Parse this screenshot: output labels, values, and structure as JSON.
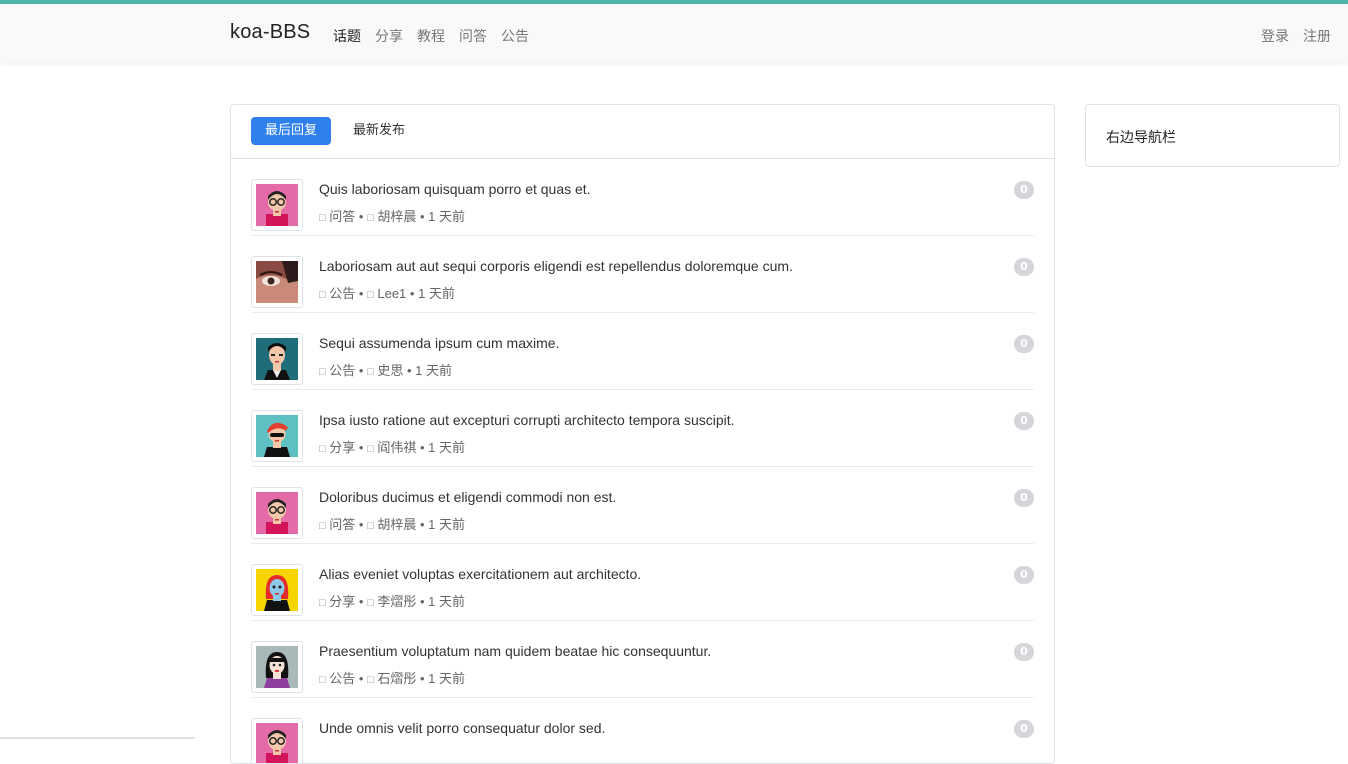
{
  "header": {
    "brand": "koa-BBS",
    "nav": [
      "话题",
      "分享",
      "教程",
      "问答",
      "公告"
    ],
    "right": [
      "登录",
      "注册"
    ]
  },
  "tabs": [
    "最后回复",
    "最新发布"
  ],
  "topics": [
    {
      "title": "Quis laboriosam quisquam porro et quas et.",
      "category": "问答",
      "author": "胡梓晨",
      "time": "1 天前",
      "count": "0",
      "avatar": "pink-glasses"
    },
    {
      "title": "Laboriosam aut aut sequi corporis eligendi est repellendus doloremque cum.",
      "category": "公告",
      "author": "Lee1",
      "time": "1 天前",
      "count": "0",
      "avatar": "photo-eye"
    },
    {
      "title": "Sequi assumenda ipsum cum maxime.",
      "category": "公告",
      "author": "史思",
      "time": "1 天前",
      "count": "0",
      "avatar": "teal-man"
    },
    {
      "title": "Ipsa iusto ratione aut excepturi corrupti architecto tempora suscipit.",
      "category": "分享",
      "author": "阎伟祺",
      "time": "1 天前",
      "count": "0",
      "avatar": "cyan-redhair"
    },
    {
      "title": "Doloribus ducimus et eligendi commodi non est.",
      "category": "问答",
      "author": "胡梓晨",
      "time": "1 天前",
      "count": "0",
      "avatar": "pink-glasses"
    },
    {
      "title": "Alias eveniet voluptas exercitationem aut architecto.",
      "category": "分享",
      "author": "李熠彤",
      "time": "1 天前",
      "count": "0",
      "avatar": "yellow-redhair"
    },
    {
      "title": "Praesentium voluptatum nam quidem beatae hic consequuntur.",
      "category": "公告",
      "author": "石熠彤",
      "time": "1 天前",
      "count": "0",
      "avatar": "grey-woman"
    },
    {
      "title": "Unde omnis velit porro consequatur dolor sed.",
      "category": "",
      "author": "",
      "time": "",
      "count": "0",
      "avatar": "pink-glasses"
    }
  ],
  "sidebar": {
    "title": "右边导航栏"
  },
  "colors": {
    "accent": "#4db6ac",
    "primary": "#2f80ed"
  }
}
